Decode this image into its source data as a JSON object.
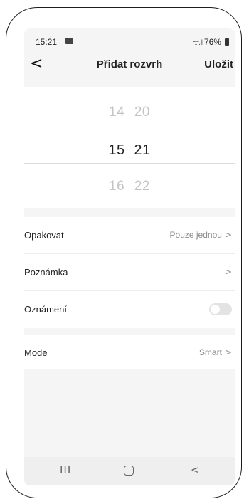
{
  "status": {
    "time": "15:21",
    "signal": "ᯤ.ıl",
    "battery": "76%"
  },
  "header": {
    "back": "<",
    "title": "Přidat rozvrh",
    "save": "Uložit"
  },
  "picker": {
    "rows": [
      {
        "hour": "14",
        "minute": "20"
      },
      {
        "hour": "15",
        "minute": "21"
      },
      {
        "hour": "16",
        "minute": "22"
      }
    ]
  },
  "settings": {
    "repeat": {
      "label": "Opakovat",
      "value": "Pouze jednou",
      "chevron": ">"
    },
    "note": {
      "label": "Poznámka",
      "chevron": ">"
    },
    "notification": {
      "label": "Oznámení",
      "enabled": false
    }
  },
  "mode": {
    "label": "Mode",
    "value": "Smart",
    "chevron": ">"
  },
  "navbar": {
    "recents": "III",
    "back": "<"
  }
}
